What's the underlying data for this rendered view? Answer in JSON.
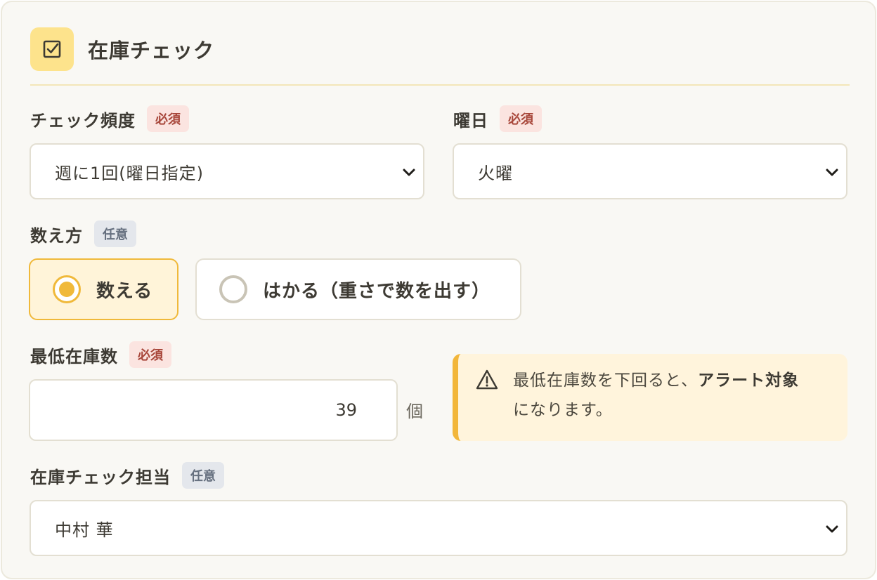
{
  "header": {
    "title": "在庫チェック",
    "icon": "checkbox-icon"
  },
  "frequency": {
    "label": "チェック頻度",
    "badge": "必須",
    "value": "週に1回(曜日指定)"
  },
  "weekday": {
    "label": "曜日",
    "badge": "必須",
    "value": "火曜"
  },
  "count_method": {
    "label": "数え方",
    "badge": "任意",
    "options": [
      {
        "label": "数える",
        "selected": true
      },
      {
        "label": "はかる（重さで数を出す）",
        "selected": false
      }
    ]
  },
  "min_stock": {
    "label": "最低在庫数",
    "badge": "必須",
    "value": "39",
    "unit": "個"
  },
  "alert": {
    "text_before": "最低在庫数を下回ると、",
    "text_bold": "アラート対象",
    "text_after": "になります。",
    "icon": "warning-icon"
  },
  "assignee": {
    "label": "在庫チェック担当",
    "badge": "任意",
    "value": "中村 華"
  },
  "colors": {
    "accent": "#f0b93a",
    "required_badge_bg": "#fbe4e0",
    "required_badge_text": "#a8473b",
    "optional_badge_bg": "#e4e7ec",
    "alert_bg": "#fff4dc"
  }
}
